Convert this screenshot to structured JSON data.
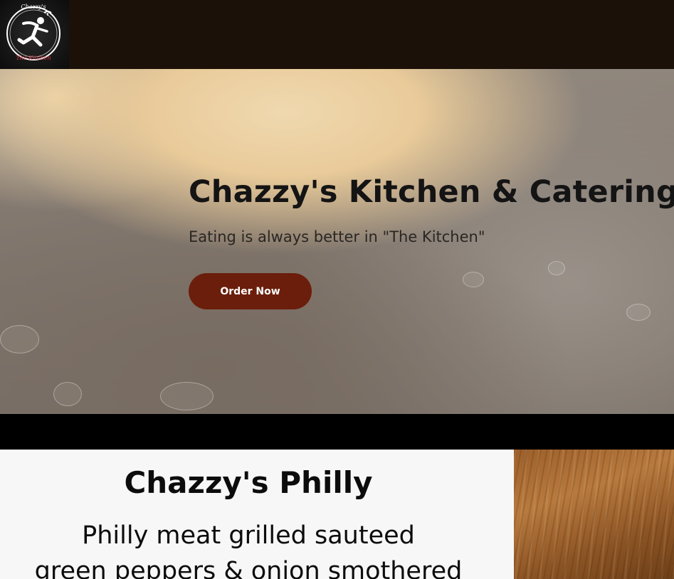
{
  "header": {
    "logo": {
      "top_text": "Chazzy's",
      "bottom_text": "The Kitchen",
      "icon": "chef-running-logo"
    }
  },
  "hero": {
    "title": "Chazzy's Kitchen & Catering",
    "subtitle": "Eating is always better in \"The Kitchen\"",
    "cta_label": "Order Now"
  },
  "menu_item": {
    "title": "Chazzy's Philly",
    "description_lines": [
      "Philly meat grilled sauteed",
      "green peppers & onion smothered"
    ]
  },
  "colors": {
    "topbar": "#1c1108",
    "cta_button": "#6b1e0b",
    "card_background": "#f7f7f7",
    "logo_accent": "#d8394a"
  }
}
